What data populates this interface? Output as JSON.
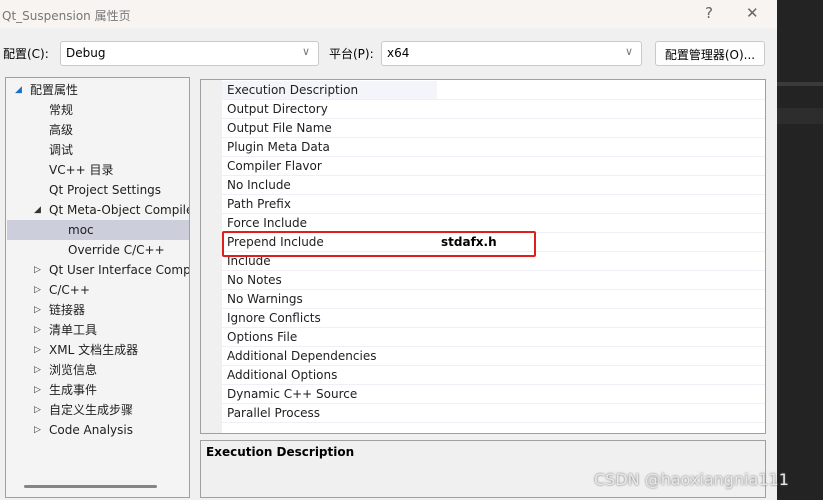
{
  "window": {
    "title": "Qt_Suspension 属性页",
    "help": "?",
    "close": "✕"
  },
  "toolbar": {
    "config_label": "配置(C):",
    "config_value": "Debug",
    "platform_label": "平台(P):",
    "platform_value": "x64",
    "manager_button": "配置管理器(O)..."
  },
  "tree": [
    {
      "label": "配置属性",
      "level": 0,
      "state": "expanded"
    },
    {
      "label": "常规",
      "level": 1
    },
    {
      "label": "高级",
      "level": 1
    },
    {
      "label": "调试",
      "level": 1
    },
    {
      "label": "VC++ 目录",
      "level": 1
    },
    {
      "label": "Qt Project Settings",
      "level": 1
    },
    {
      "label": "Qt Meta-Object Compiler",
      "level": 1,
      "state": "expanded"
    },
    {
      "label": "moc",
      "level": 2,
      "selected": true
    },
    {
      "label": "Override C/C++",
      "level": 2
    },
    {
      "label": "Qt User Interface Compiler",
      "level": 1,
      "state": "collapsed"
    },
    {
      "label": "C/C++",
      "level": 1,
      "state": "collapsed"
    },
    {
      "label": "链接器",
      "level": 1,
      "state": "collapsed"
    },
    {
      "label": "清单工具",
      "level": 1,
      "state": "collapsed"
    },
    {
      "label": "XML 文档生成器",
      "level": 1,
      "state": "collapsed"
    },
    {
      "label": "浏览信息",
      "level": 1,
      "state": "collapsed"
    },
    {
      "label": "生成事件",
      "level": 1,
      "state": "collapsed"
    },
    {
      "label": "自定义生成步骤",
      "level": 1,
      "state": "collapsed"
    },
    {
      "label": "Code Analysis",
      "level": 1,
      "state": "collapsed"
    }
  ],
  "properties": [
    {
      "name": "Execution Description",
      "value": ""
    },
    {
      "name": "Output Directory",
      "value": ""
    },
    {
      "name": "Output File Name",
      "value": ""
    },
    {
      "name": "Plugin Meta Data",
      "value": ""
    },
    {
      "name": "Compiler Flavor",
      "value": ""
    },
    {
      "name": "No Include",
      "value": ""
    },
    {
      "name": "Path Prefix",
      "value": ""
    },
    {
      "name": "Force Include",
      "value": ""
    },
    {
      "name": "Prepend Include",
      "value": "stdafx.h",
      "highlighted": true
    },
    {
      "name": "Include",
      "value": ""
    },
    {
      "name": "No Notes",
      "value": ""
    },
    {
      "name": "No Warnings",
      "value": ""
    },
    {
      "name": "Ignore Conflicts",
      "value": ""
    },
    {
      "name": "Options File",
      "value": ""
    },
    {
      "name": "Additional Dependencies",
      "value": ""
    },
    {
      "name": "Additional Options",
      "value": ""
    },
    {
      "name": "Dynamic C++ Source",
      "value": ""
    },
    {
      "name": "Parallel Process",
      "value": ""
    }
  ],
  "description": {
    "title": "Execution Description"
  },
  "watermark": "CSDN @haoxiangnia111",
  "colors": {
    "highlight_box": "#e01e1e",
    "selection": "#cccedb"
  }
}
